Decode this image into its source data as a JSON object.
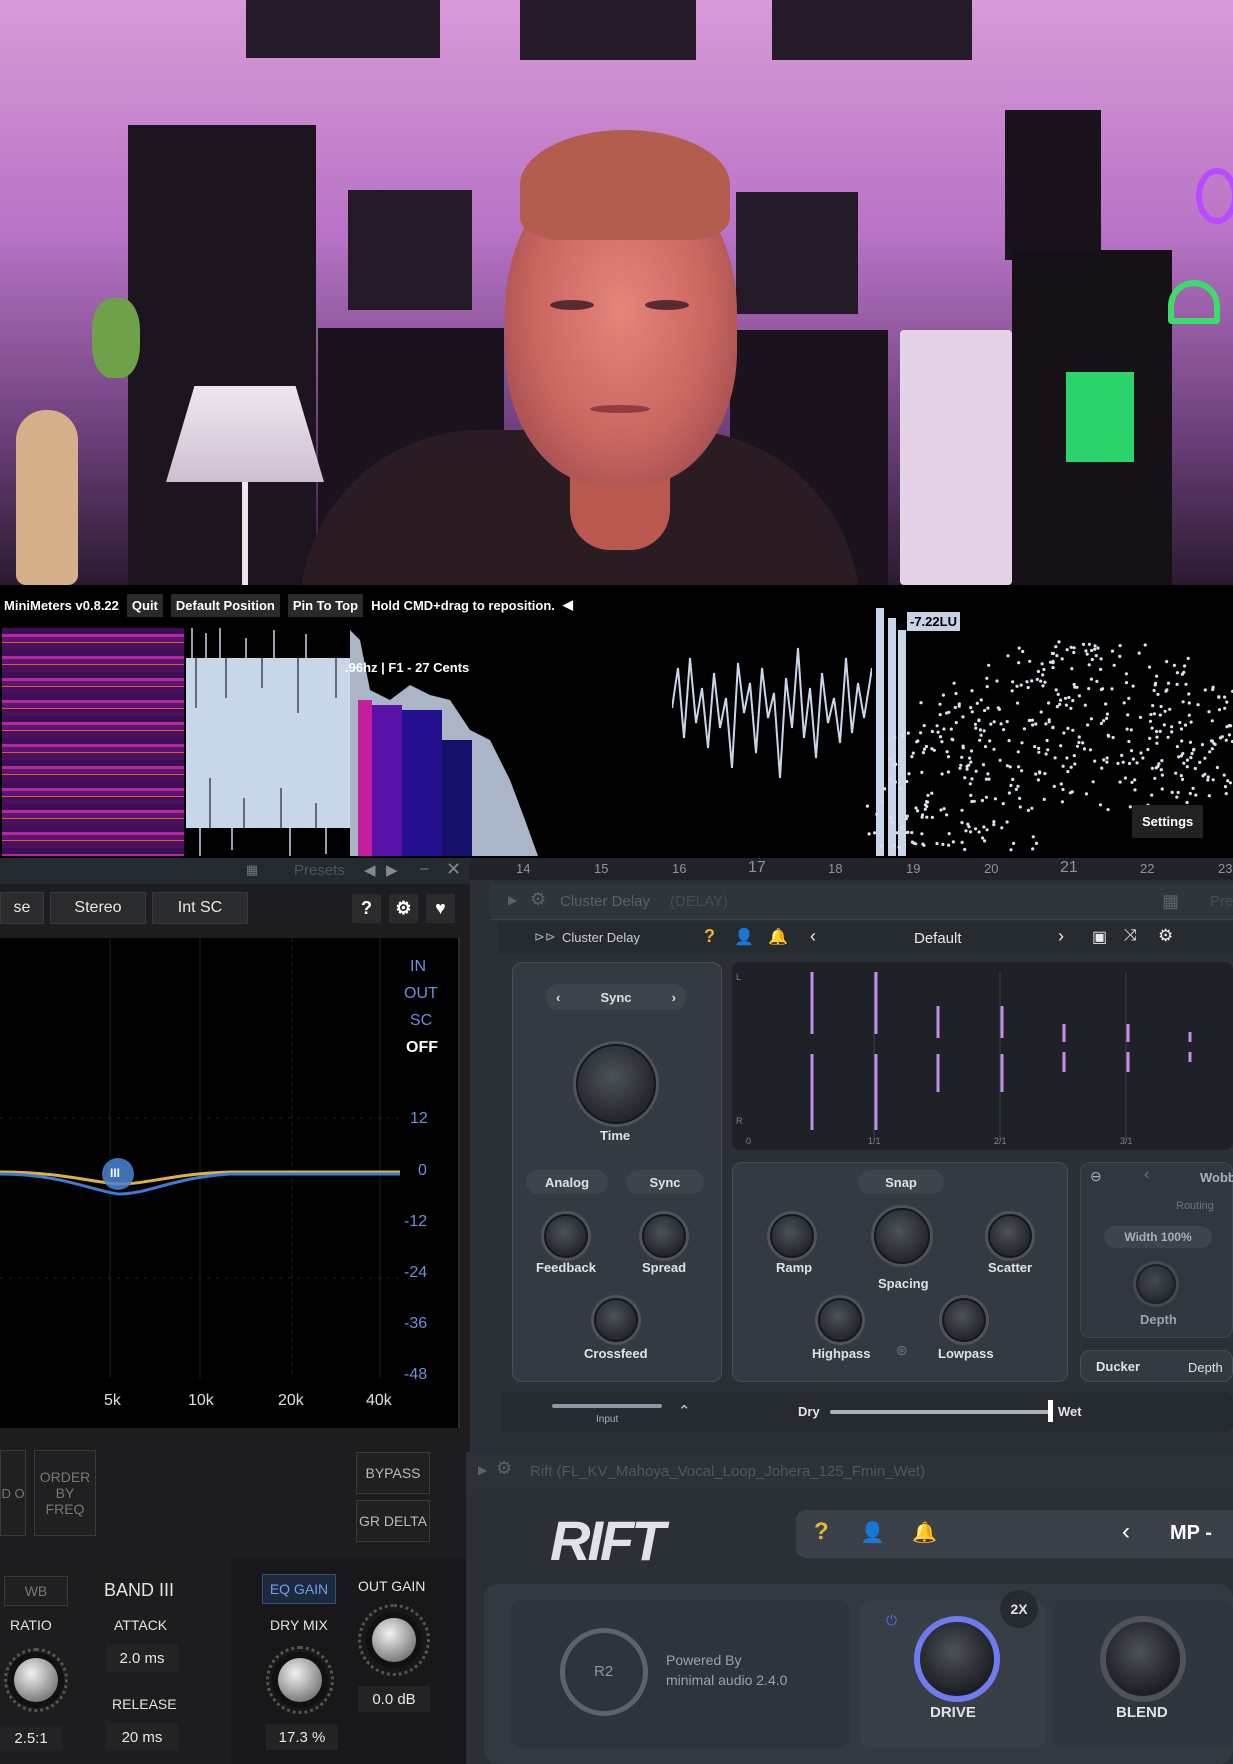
{
  "minimeters": {
    "version_label": "MiniMeters v0.8.22",
    "quit": "Quit",
    "default_position": "Default Position",
    "pin_to_top": "Pin To Top",
    "hint": "Hold CMD+drag to reposition.",
    "arrow": "◀",
    "note_readout": ".96hz | F1 - 27 Cents",
    "lufs": "-7.22LU",
    "settings": "Settings"
  },
  "eq": {
    "presets": "Presets",
    "tabs": [
      "se",
      "Stereo",
      "Int SC"
    ],
    "help": "?",
    "io_labels": [
      "IN",
      "OUT",
      "SC",
      "OFF"
    ],
    "db_labels": [
      "12",
      "0",
      "-12",
      "-24",
      "-36",
      "-48"
    ],
    "freq_labels": [
      "5k",
      "10k",
      "20k",
      "40k"
    ],
    "band_node": "III",
    "order_by_freq": "ORDER BY FREQ",
    "bypass": "BYPASS",
    "gr_delta": "GR DELTA",
    "wb": "WB",
    "band_title": "BAND III",
    "ratio_label": "RATIO",
    "ratio_value": "2.5:1",
    "attack_label": "ATTACK",
    "attack_value": "2.0 ms",
    "release_label": "RELEASE",
    "release_value": "20 ms",
    "eq_gain": "EQ GAIN",
    "out_gain": "OUT GAIN",
    "dry_mix": "DRY MIX",
    "dry_mix_value": "17.3 %",
    "out_gain_value": "0.0 dB",
    "left_edge": "D O"
  },
  "daw": {
    "ruler": [
      "14",
      "15",
      "16",
      "17",
      "18",
      "19",
      "20",
      "21",
      "22",
      "23"
    ]
  },
  "cluster_delay": {
    "window_title": "Cluster Delay",
    "window_subtitle": "(DELAY)",
    "window_right": "Pre",
    "plugin_name": "Cluster Delay",
    "help": "?",
    "preset": "Default",
    "sync": "Sync",
    "time": "Time",
    "analog": "Analog",
    "sync2": "Sync",
    "feedback": "Feedback",
    "spread": "Spread",
    "crossfeed": "Crossfeed",
    "snap": "Snap",
    "ramp": "Ramp",
    "spacing": "Spacing",
    "scatter": "Scatter",
    "highpass": "Highpass",
    "lowpass": "Lowpass",
    "wobble": "Wobb",
    "routing": "Routing",
    "width": "Width 100%",
    "depth": "Depth",
    "ducker": "Ducker",
    "depth2": "Depth",
    "input": "Input",
    "dry": "Dry",
    "wet": "Wet",
    "vis_axis": [
      "0",
      "1/1",
      "2/1",
      "3/1"
    ],
    "vis_channels": [
      "L",
      "R"
    ]
  },
  "rift": {
    "window_title": "Rift (FL_KV_Mahoya_Vocal_Loop_Johera_125_Fmin_Wet)",
    "logo": "RIFT",
    "help": "?",
    "preset": "MP -",
    "r2": "R2",
    "powered_by": "Powered By",
    "powered_by_line2": "minimal audio 2.4.0",
    "two_x": "2X",
    "drive": "DRIVE",
    "blend": "BLEND"
  }
}
